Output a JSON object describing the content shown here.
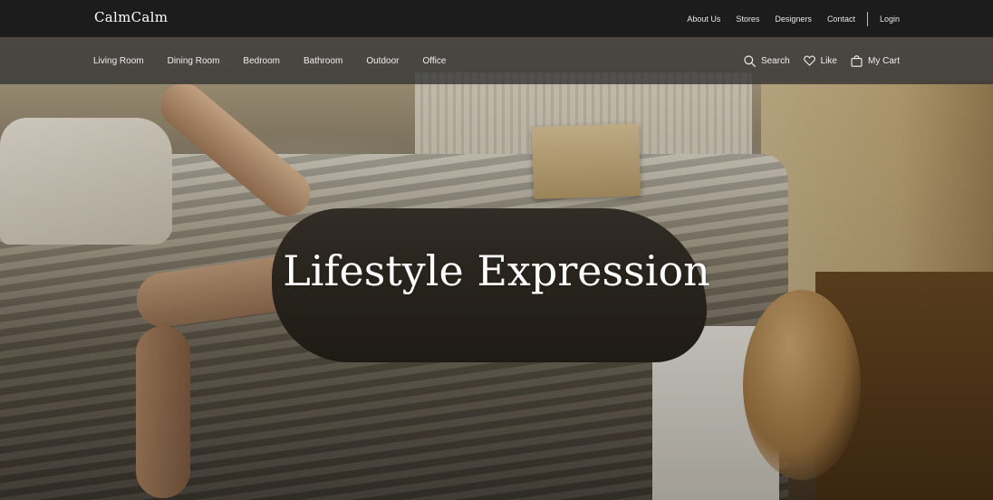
{
  "brand": {
    "name": "CalmCalm"
  },
  "top_nav": {
    "links": [
      "About Us",
      "Stores",
      "Designers",
      "Contact"
    ],
    "login": "Login"
  },
  "category_nav": {
    "items": [
      "Living Room",
      "Dining Room",
      "Bedroom",
      "Bathroom",
      "Outdoor",
      "Office"
    ]
  },
  "actions": {
    "search": {
      "label": "Search",
      "icon": "search-icon"
    },
    "like": {
      "label": "Like",
      "icon": "heart-icon"
    },
    "cart": {
      "label": "My Cart",
      "icon": "shopping-bag-icon"
    }
  },
  "hero": {
    "headline": "Lifestyle Expression"
  },
  "colors": {
    "topbar_bg": "#1c1c1c",
    "catbar_bg": "#323232",
    "text": "#ffffff"
  }
}
